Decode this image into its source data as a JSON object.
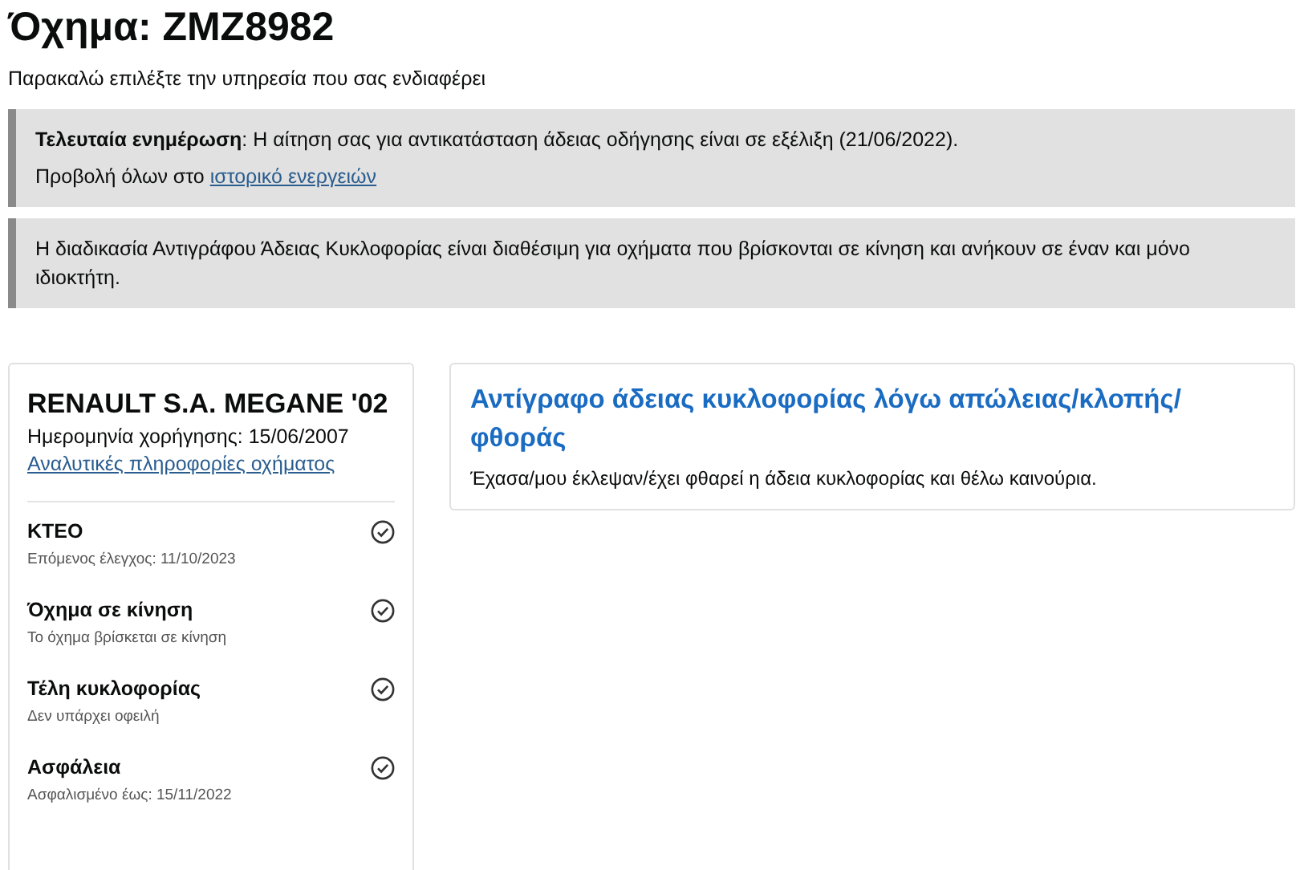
{
  "title": "Όχημα: ZMZ8982",
  "subtitle": "Παρακαλώ επιλέξτε την υπηρεσία που σας ενδιαφέρει",
  "notices": [
    {
      "text": "**Τελευταία ενημέρωση**: Η αίτηση σας για αντικατάσταση άδειας οδήγησης είναι σε εξέλιξη (21/06/2022).",
      "link_prefix": "Προβολή όλων στο",
      "link": "ιστορικό ενεργειών"
    },
    {
      "text": "Η διαδικασία Αντιγράφου Άδειας Κυκλοφορίας είναι διαθέσιμη για οχήματα που βρίσκονται σε κίνηση και ανήκουν σε έναν και μόνο ιδιοκτήτη."
    }
  ],
  "vehicle": {
    "name": "RENAULT S.A. MEGANE '02",
    "issue_date": "Ημερομηνία χορήγησης: 15/06/2007",
    "details_link": "Αναλυτικές πληροφορίες οχήματος",
    "checks": [
      {
        "title": "ΚΤΕΟ",
        "detail": "Επόμενος έλεγχος: 11/10/2023",
        "ok": true
      },
      {
        "title": "Όχημα σε κίνηση",
        "detail": "Το όχημα βρίσκεται σε κίνηση",
        "ok": true
      },
      {
        "title": "Τέλη κυκλοφορίας",
        "detail": "Δεν υπάρχει οφειλή",
        "ok": true
      },
      {
        "title": "Ασφάλεια",
        "detail": "Ασφαλισμένο έως: 15/11/2022",
        "ok": true
      }
    ]
  },
  "services": [
    {
      "title": "Αντίγραφο άδειας κυκλοφορίας λόγω απώλειας/κλοπής/ φθοράς",
      "description": "Έχασα/μου έκλεψαν/έχει φθαρεί η άδεια κυκλοφορίας και θέλω καινούρια."
    }
  ]
}
